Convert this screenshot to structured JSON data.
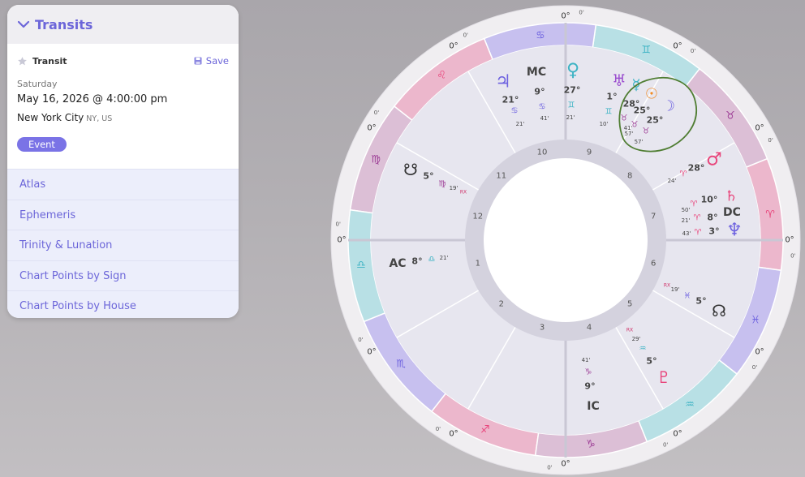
{
  "panel": {
    "title": "Transits",
    "chart_type": "Transit",
    "save_label": "Save",
    "weekday": "Saturday",
    "datetime": "May 16, 2026 @ 4:00:00 pm",
    "location_city": "New York City",
    "location_sub": "NY, US",
    "badge": "Event",
    "menu": [
      "Atlas",
      "Ephemeris",
      "Trinity & Lunation",
      "Chart Points by Sign",
      "Chart Points by House"
    ]
  },
  "wheel": {
    "sign_order": [
      "aries",
      "taurus",
      "gemini",
      "cancer",
      "leo",
      "virgo",
      "libra",
      "scorpio",
      "sagittarius",
      "capricorn",
      "aquarius",
      "pisces"
    ],
    "sign_glyphs": {
      "aries": "♈",
      "taurus": "♉",
      "gemini": "♊",
      "cancer": "♋",
      "leo": "♌",
      "virgo": "♍",
      "libra": "♎",
      "scorpio": "♏",
      "sagittarius": "♐",
      "capricorn": "♑",
      "aquarius": "♒",
      "pisces": "♓"
    },
    "sign_colors": {
      "aries": "#e8457b",
      "taurus": "#9d3d96",
      "gemini": "#3db3c4",
      "cancer": "#6f63e0",
      "leo": "#e8457b",
      "virgo": "#9d3d96",
      "libra": "#3db3c4",
      "scorpio": "#6f63e0",
      "sagittarius": "#e8457b",
      "capricorn": "#9d3d96",
      "aquarius": "#3db3c4",
      "pisces": "#6f63e0"
    },
    "sign_fills": {
      "aries": "#ecb7cc",
      "taurus": "#dcbfd6",
      "gemini": "#b8e0e5",
      "cancer": "#c7c0ef",
      "leo": "#ecb7cc",
      "virgo": "#dcbfd6",
      "libra": "#b8e0e5",
      "scorpio": "#c7c0ef",
      "sagittarius": "#ecb7cc",
      "capricorn": "#dcbfd6",
      "aquarius": "#b8e0e5",
      "pisces": "#c7c0ef"
    },
    "cusp_degree_main": "0°",
    "cusp_degree_minor": "0'",
    "house_numbers": [
      "1",
      "2",
      "3",
      "4",
      "5",
      "6",
      "7",
      "8",
      "9",
      "10",
      "11",
      "12"
    ],
    "angles": {
      "asc": "AC",
      "dsc": "DC",
      "mc": "MC",
      "ic": "IC"
    },
    "angle_degrees": {
      "asc": {
        "deg": "8°",
        "sign": "libra",
        "min": "21'"
      },
      "mc": {
        "deg": "9°",
        "sign": "cancer",
        "min": "41'"
      },
      "ic": {
        "deg": "9°",
        "sign": "capricorn",
        "min": "41'"
      }
    },
    "planets": [
      {
        "key": "jupiter",
        "glyph": "♃",
        "color": "#6f63e0",
        "deg": "21°",
        "sign": "cancer",
        "min": "21'"
      },
      {
        "key": "venus",
        "glyph": "♀",
        "color": "#3db3c4",
        "deg": "27°",
        "sign": "gemini",
        "min": "21'"
      },
      {
        "key": "uranus",
        "glyph": "♅",
        "color": "#9b4fcf",
        "deg": "1°",
        "sign": "gemini",
        "min": "10'"
      },
      {
        "key": "mercury",
        "glyph": "☿",
        "color": "#3db3c4",
        "deg": "28°",
        "sign": "taurus",
        "min": "41'"
      },
      {
        "key": "sun",
        "glyph": "☉",
        "color": "#f08a24",
        "deg": "25°",
        "sign": "taurus",
        "min": "57'"
      },
      {
        "key": "moon",
        "glyph": "☽",
        "color": "#6f63e0",
        "deg": "25°",
        "sign": "taurus",
        "min": "57'"
      },
      {
        "key": "mars",
        "glyph": "♂",
        "color": "#e8457b",
        "deg": "28°",
        "sign": "aries",
        "min": "24'"
      },
      {
        "key": "saturn",
        "glyph": "♄",
        "color": "#e8457b",
        "deg": "10°",
        "sign": "aries",
        "min": "50'"
      },
      {
        "key": "neptune",
        "glyph": "♆",
        "color": "#6f63e0",
        "deg": "3°",
        "sign": "aries",
        "min": "43'"
      },
      {
        "key": "northnode",
        "glyph": "☊",
        "color": "#333333",
        "deg": "5°",
        "sign": "pisces",
        "min": "19'",
        "rx": "RX"
      },
      {
        "key": "pluto",
        "glyph": "♇",
        "color": "#e8457b",
        "deg": "5°",
        "sign": "aquarius",
        "min": "29'",
        "rx": "RX"
      },
      {
        "key": "southnode",
        "glyph": "☋",
        "color": "#333333",
        "deg": "5°",
        "sign": "virgo",
        "min": "19'",
        "rx": "RX"
      }
    ],
    "extra": {
      "deg": "8°",
      "sign": "aries",
      "min": "21'"
    }
  }
}
